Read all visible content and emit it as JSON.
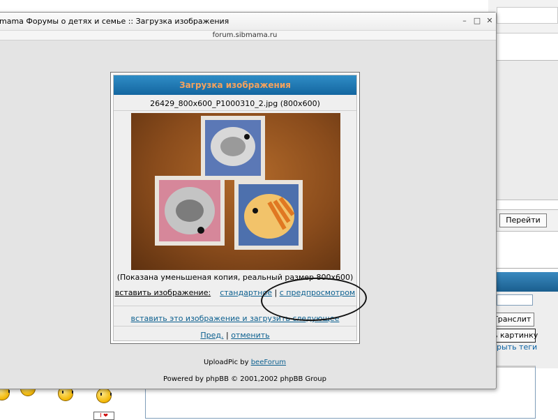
{
  "window": {
    "title": "mama Форумы о детях и семье :: Загрузка изображения",
    "url": "forum.sibmama.ru",
    "controls": {
      "minimize": "–",
      "maximize": "□",
      "close": "✕"
    }
  },
  "upload": {
    "header": "Загрузка изображения",
    "file_info": "26429_800x600_P1000310_2.jpg (800x600)",
    "photo_alt": "Фото: три вышитых кота",
    "note": "(Показана уменьшеная копия, реальный размер 800x600)",
    "insert_label": "вставить изображение:",
    "insert_standard": "стандартное",
    "divider": "|",
    "insert_preview": "с предпросмотром",
    "insert_and_next": "вставить это изображение и загрузить следующее",
    "prev": "Пред.",
    "cancel": "отменить"
  },
  "footer": {
    "uploadpic_prefix": "UploadPic by ",
    "uploadpic_link": "beeForum",
    "powered": "Powered by phpBB © 2001,2002 phpBB Group"
  },
  "background": {
    "go_button": "Перейти",
    "translit_button": "Транслит",
    "picture_button": "ь картинку",
    "hide_tags": "рыть теги",
    "card_text": "I ❤"
  }
}
